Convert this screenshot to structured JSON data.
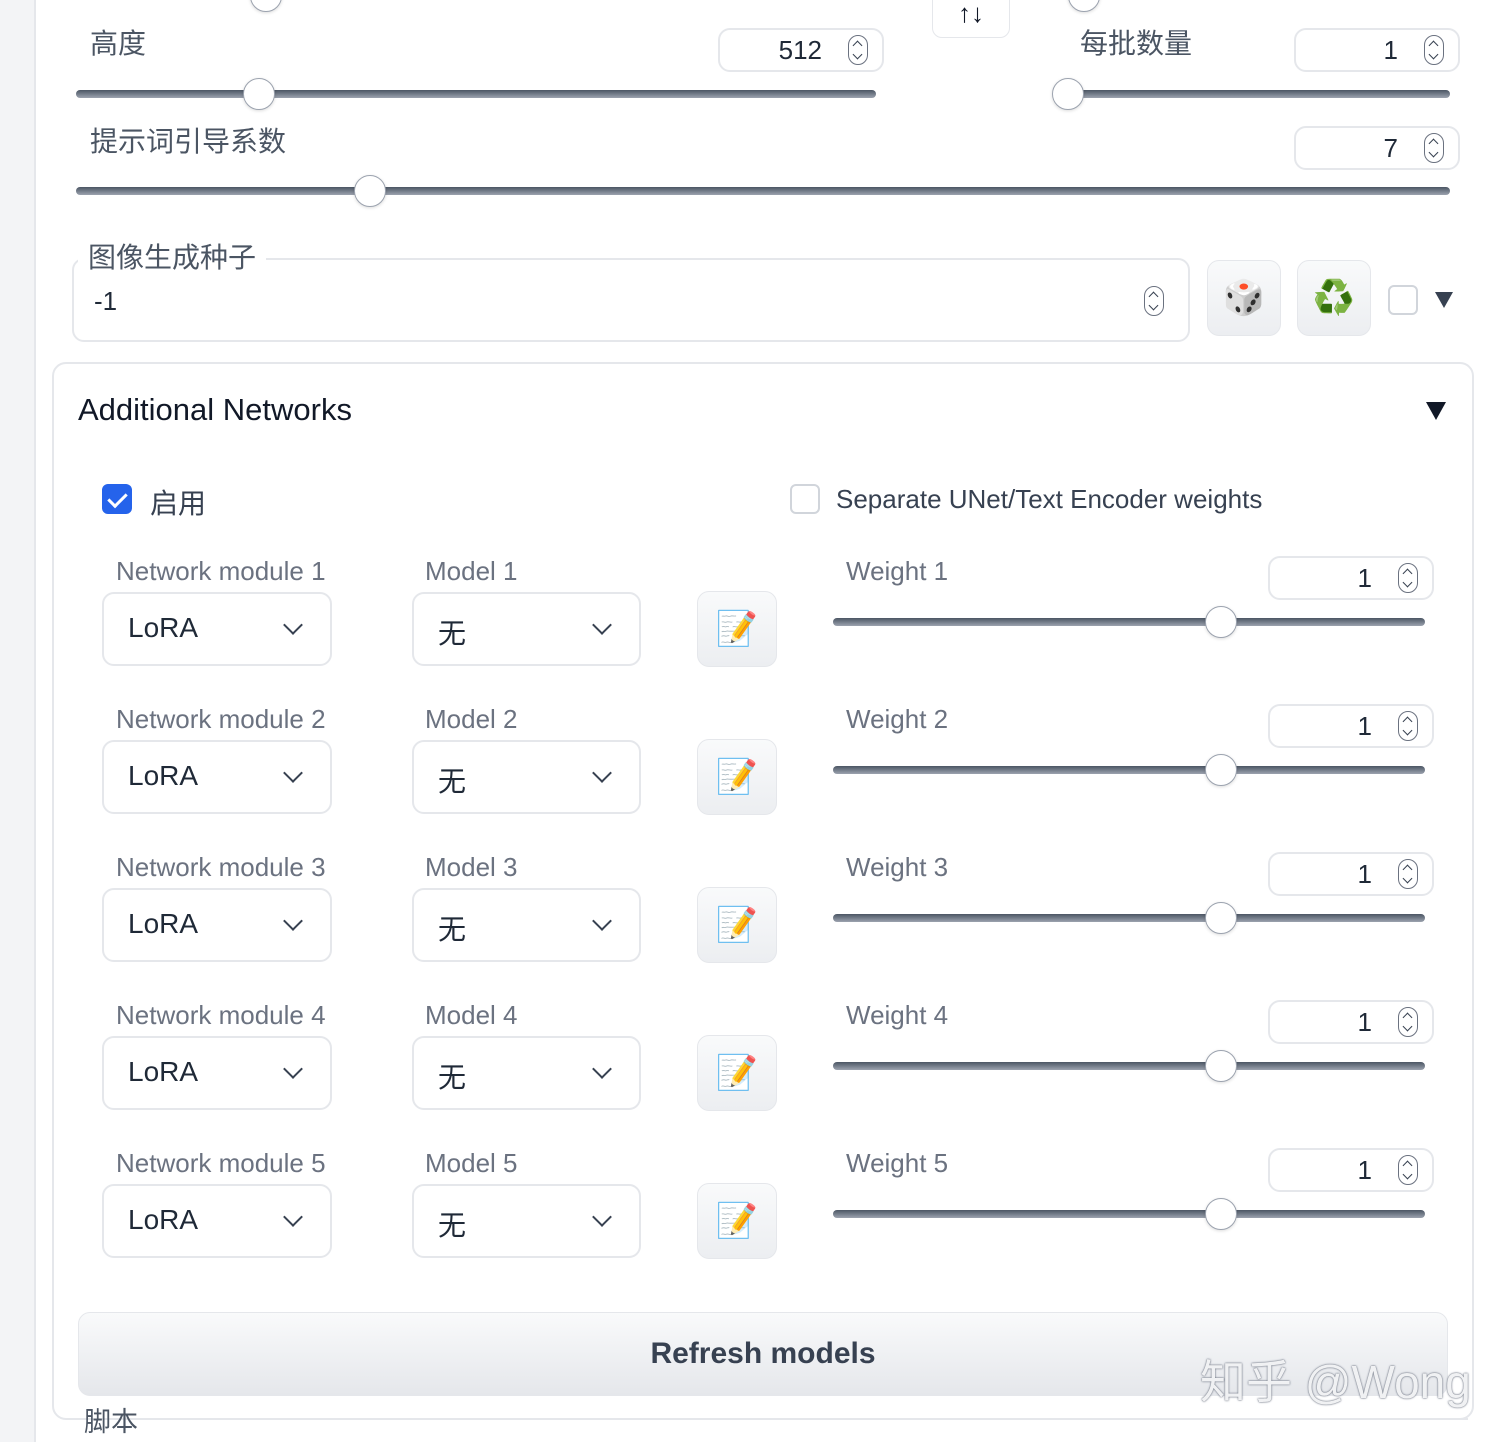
{
  "generation": {
    "height": {
      "label": "高度",
      "value": "512",
      "fraction": 0.2285
    },
    "batch_size": {
      "label": "每批数量",
      "value": "1",
      "fraction": 0.0
    },
    "cfg_scale": {
      "label": "提示词引导系数",
      "value": "7",
      "fraction": 0.2138
    },
    "swap_icon": "↑↓"
  },
  "seed": {
    "label": "图像生成种子",
    "value": "-1",
    "random_icon": "🎲",
    "reuse_icon": "♻️",
    "extra_checked": false
  },
  "additional_networks": {
    "title": "Additional Networks",
    "enable_label": "启用",
    "enable_checked": true,
    "separate_label": "Separate UNet/Text Encoder weights",
    "separate_checked": false,
    "edit_icon": "📝",
    "rows": [
      {
        "module_label": "Network module 1",
        "module_value": "LoRA",
        "model_label": "Model 1",
        "model_value": "无",
        "weight_label": "Weight 1",
        "weight_value": "1",
        "weight_fraction": 0.6553
      },
      {
        "module_label": "Network module 2",
        "module_value": "LoRA",
        "model_label": "Model 2",
        "model_value": "无",
        "weight_label": "Weight 2",
        "weight_value": "1",
        "weight_fraction": 0.6553
      },
      {
        "module_label": "Network module 3",
        "module_value": "LoRA",
        "model_label": "Model 3",
        "model_value": "无",
        "weight_label": "Weight 3",
        "weight_value": "1",
        "weight_fraction": 0.6553
      },
      {
        "module_label": "Network module 4",
        "module_value": "LoRA",
        "model_label": "Model 4",
        "model_value": "无",
        "weight_label": "Weight 4",
        "weight_value": "1",
        "weight_fraction": 0.6553
      },
      {
        "module_label": "Network module 5",
        "module_value": "LoRA",
        "model_label": "Model 5",
        "model_value": "无",
        "weight_label": "Weight 5",
        "weight_value": "1",
        "weight_fraction": 0.6553
      }
    ],
    "refresh_label": "Refresh models"
  },
  "scripts": {
    "label": "脚本"
  },
  "watermark": "知乎 @Wong"
}
